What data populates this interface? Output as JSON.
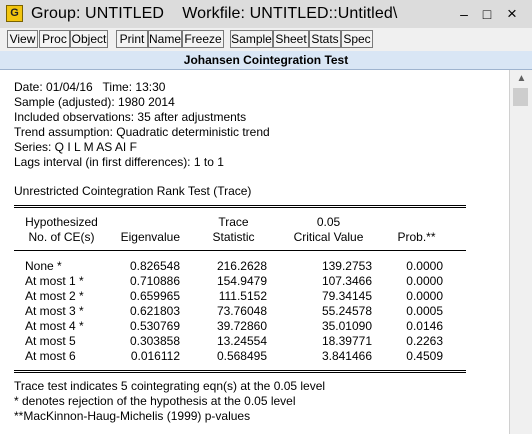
{
  "window": {
    "app_icon_letter": "G",
    "title": "Group: UNTITLED    Workfile: UNTITLED::Untitled\\",
    "controls": {
      "minimize": "–",
      "maximize": "□",
      "close": "×"
    }
  },
  "toolbar": {
    "buttons": [
      "View",
      "Proc",
      "Object",
      "Print",
      "Name",
      "Freeze",
      "Sample",
      "Sheet",
      "Stats",
      "Spec"
    ]
  },
  "output": {
    "header": "Johansen Cointegration Test",
    "info_lines": [
      "Date: 01/04/16   Time: 13:30",
      "Sample (adjusted): 1980 2014",
      "Included observations: 35 after adjustments",
      "Trend assumption: Quadratic deterministic trend",
      "Series: Q I L M AS AI F",
      "Lags interval (in first differences): 1 to 1"
    ],
    "table_title": "Unrestricted Cointegration Rank Test (Trace)",
    "columns": {
      "c1_line1": "Hypothesized",
      "c1_line2": "No. of CE(s)",
      "c2": "Eigenvalue",
      "c3_line1": "Trace",
      "c3_line2": "Statistic",
      "c4_line1": "0.05",
      "c4_line2": "Critical Value",
      "c5": "Prob.**"
    },
    "rows": [
      [
        "None *",
        "0.826548",
        "216.2628",
        "139.2753",
        "0.0000"
      ],
      [
        "At most 1 *",
        "0.710886",
        "154.9479",
        "107.3466",
        "0.0000"
      ],
      [
        "At most 2 *",
        "0.659965",
        "111.5152",
        "79.34145",
        "0.0000"
      ],
      [
        "At most 3 *",
        "0.621803",
        "73.76048",
        "55.24578",
        "0.0005"
      ],
      [
        "At most 4 *",
        "0.530769",
        "39.72860",
        "35.01090",
        "0.0146"
      ],
      [
        "At most 5",
        "0.303858",
        "13.24554",
        "18.39771",
        "0.2263"
      ],
      [
        "At most 6",
        "0.016112",
        "0.568495",
        "3.841466",
        "0.4509"
      ]
    ],
    "notes": [
      "Trace test indicates 5 cointegrating eqn(s) at the 0.05 level",
      "* denotes rejection of the hypothesis at the 0.05 level",
      "**MacKinnon-Haug-Michelis (1999) p-values"
    ]
  }
}
